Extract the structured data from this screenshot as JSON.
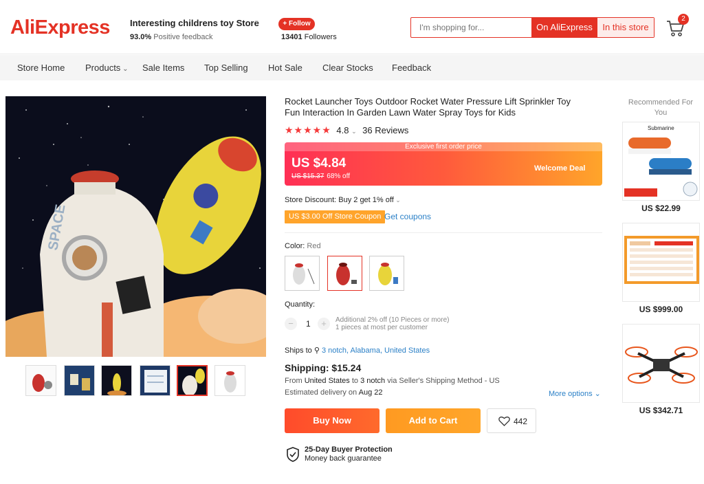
{
  "header": {
    "logo": "AliExpress",
    "store_name": "Interesting childrens toy Store",
    "positive_pct": "93.0%",
    "positive_label": "Positive feedback",
    "follow_label": "+ Follow",
    "followers_count": "13401",
    "followers_label": "Followers",
    "search_placeholder": "I'm shopping for...",
    "search_on_aliexpress": "On AliExpress",
    "search_in_store": "In this store",
    "cart_count": "2"
  },
  "nav": {
    "items": [
      "Store Home",
      "Products",
      "Sale Items",
      "Top Selling",
      "Hot Sale",
      "Clear Stocks",
      "Feedback"
    ]
  },
  "product": {
    "title": "Rocket Launcher Toys Outdoor Rocket Water Pressure Lift Sprinkler Toy Fun Interaction In Garden Lawn Water Spray Toys for Kids",
    "rating": "4.8",
    "stars_value": 5,
    "reviews": "36 Reviews",
    "price_banner": "Exclusive first order price",
    "price": "US $4.84",
    "old_price": "US $15.37",
    "discount_pct": "68% off",
    "welcome_deal": "Welcome Deal",
    "store_discount": "Store Discount: Buy 2 get 1% off",
    "coupon": "US $3.00 Off Store Coupon",
    "get_coupons": "Get coupons",
    "color_label": "Color:",
    "color_value": "Red",
    "quantity_label": "Quantity:",
    "quantity": "1",
    "qty_note_1": "Additional 2% off (10 Pieces or more)",
    "qty_note_2": "1 pieces at most per customer",
    "ships_to_label": "Ships to",
    "ships_to": "3 notch, Alabama, United States",
    "shipping": "Shipping: $15.24",
    "ship_from_prefix": "From",
    "ship_from_country": "United States",
    "ship_from_to": "to",
    "ship_from_dest": "3 notch",
    "ship_method": "via Seller's Shipping Method - US",
    "est_delivery_label": "Estimated delivery on",
    "est_delivery_date": "Aug 22",
    "more_options": "More options",
    "buy_now": "Buy Now",
    "add_to_cart": "Add to Cart",
    "wishlist_count": "442",
    "protection_title": "25-Day Buyer Protection",
    "protection_sub": "Money back guarantee"
  },
  "recommended": {
    "title": "Recommended For You",
    "items": [
      {
        "price": "US $22.99",
        "label": "Submarine"
      },
      {
        "price": "US $999.00"
      },
      {
        "price": "US $342.71"
      }
    ]
  },
  "colors": {
    "brand": "#e43225",
    "link": "#2b80c7",
    "coupon": "#ffa42b",
    "star": "#f53a3a"
  }
}
